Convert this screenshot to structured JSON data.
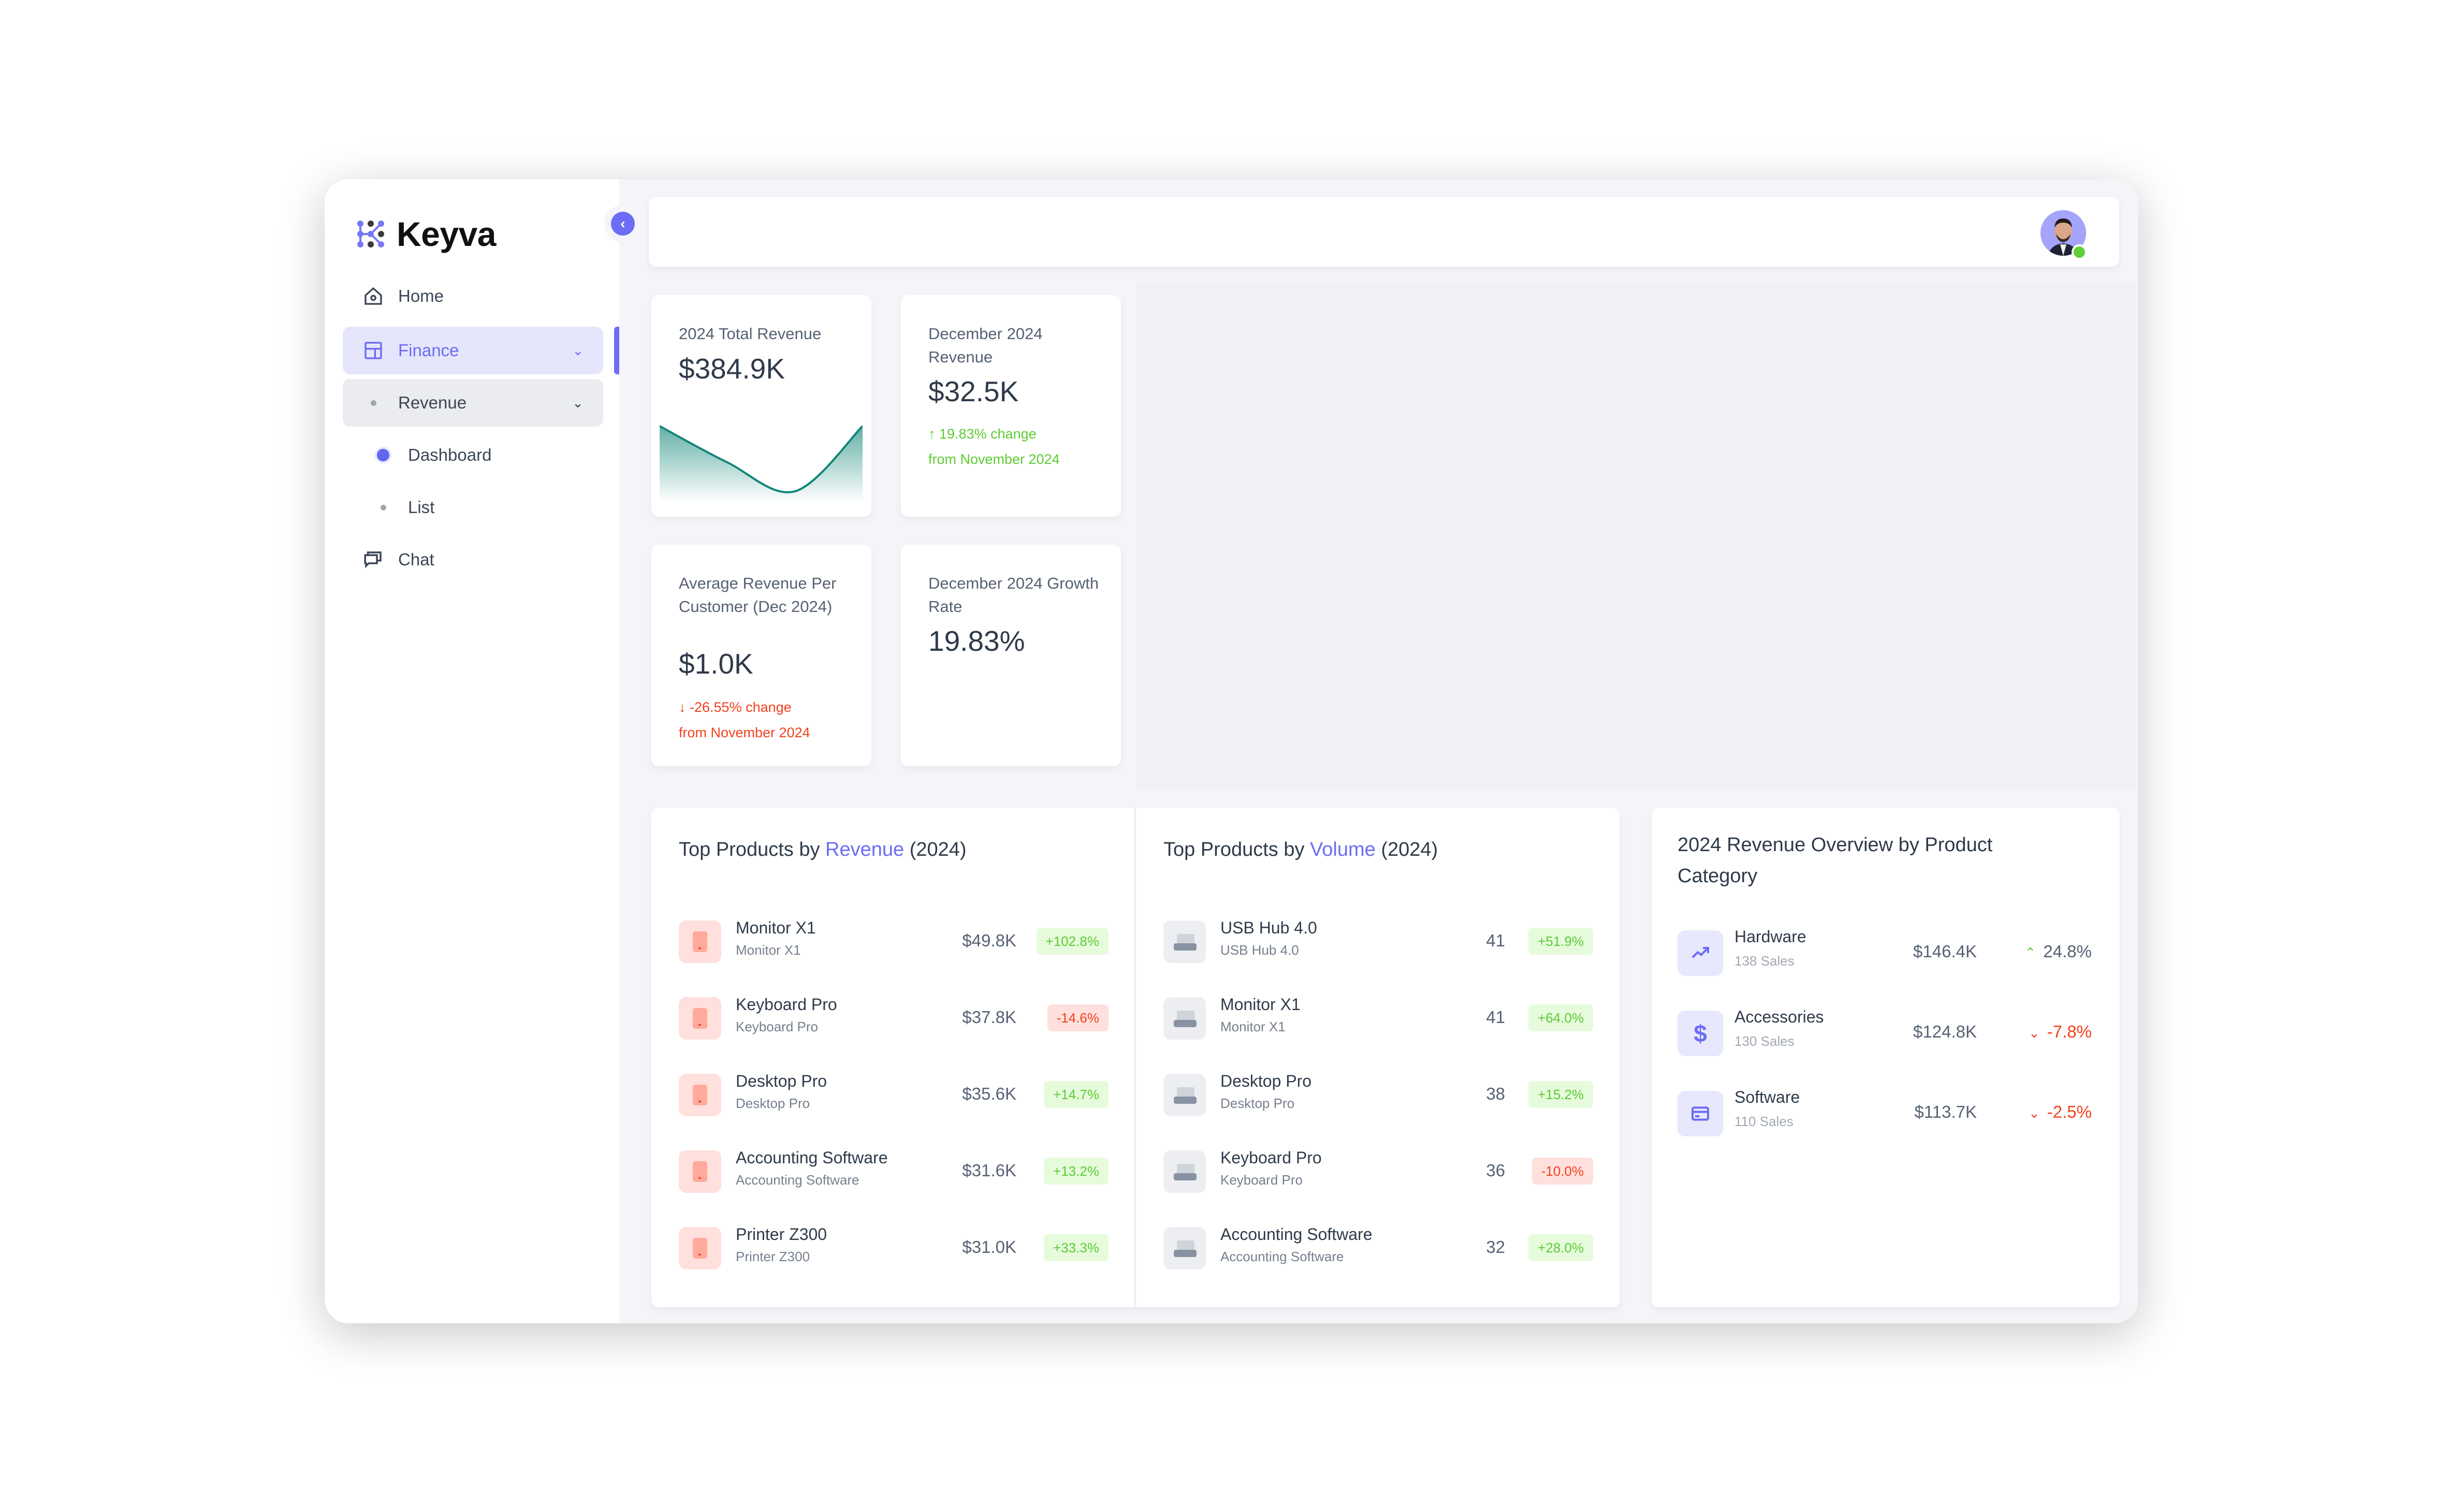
{
  "app": {
    "brand": "Keyva"
  },
  "sidebar": {
    "collapse_icon": "chevron-left-icon",
    "items": [
      {
        "label": "Home",
        "icon": "home-icon"
      },
      {
        "label": "Finance",
        "icon": "layout-icon",
        "expanded": true,
        "active": true
      },
      {
        "label": "Revenue",
        "icon": "dot-icon",
        "expanded": true
      },
      {
        "label": "Dashboard",
        "icon": "dot-icon",
        "active": true
      },
      {
        "label": "List",
        "icon": "dot-icon"
      },
      {
        "label": "Chat",
        "icon": "chat-icon"
      }
    ]
  },
  "header": {
    "avatar": "user-avatar",
    "status": "online"
  },
  "kpis": [
    {
      "title": "2024 Total Revenue",
      "value": "$384.9K",
      "sparkline": [
        0.95,
        0.45,
        0.05,
        0.95
      ]
    },
    {
      "title": "December 2024 Revenue",
      "value": "$32.5K",
      "change": "19.83% change",
      "change_suffix": "from November 2024",
      "direction": "up"
    },
    {
      "title": "Average Revenue Per Customer (Dec 2024)",
      "value": "$1.0K",
      "change": "-26.55% change",
      "change_suffix": "from November 2024",
      "direction": "down"
    },
    {
      "title": "December 2024 Growth Rate",
      "value": "19.83%"
    }
  ],
  "top_revenue": {
    "title_prefix": "Top Products by",
    "title_highlight": "Revenue",
    "title_suffix": "(2024)",
    "rows": [
      {
        "name": "Monitor X1",
        "sub": "Monitor X1",
        "value": "$49.8K",
        "change": "+102.8%",
        "positive": true
      },
      {
        "name": "Keyboard Pro",
        "sub": "Keyboard Pro",
        "value": "$37.8K",
        "change": "-14.6%",
        "positive": false
      },
      {
        "name": "Desktop Pro",
        "sub": "Desktop Pro",
        "value": "$35.6K",
        "change": "+14.7%",
        "positive": true
      },
      {
        "name": "Accounting Software",
        "sub": "Accounting Software",
        "value": "$31.6K",
        "change": "+13.2%",
        "positive": true
      },
      {
        "name": "Printer Z300",
        "sub": "Printer Z300",
        "value": "$31.0K",
        "change": "+33.3%",
        "positive": true
      }
    ]
  },
  "top_volume": {
    "title_prefix": "Top Products by",
    "title_highlight": "Volume",
    "title_suffix": "(2024)",
    "rows": [
      {
        "name": "USB Hub 4.0",
        "sub": "USB Hub 4.0",
        "value": "41",
        "change": "+51.9%",
        "positive": true
      },
      {
        "name": "Monitor X1",
        "sub": "Monitor X1",
        "value": "41",
        "change": "+64.0%",
        "positive": true
      },
      {
        "name": "Desktop Pro",
        "sub": "Desktop Pro",
        "value": "38",
        "change": "+15.2%",
        "positive": true
      },
      {
        "name": "Keyboard Pro",
        "sub": "Keyboard Pro",
        "value": "36",
        "change": "-10.0%",
        "positive": false
      },
      {
        "name": "Accounting Software",
        "sub": "Accounting Software",
        "value": "32",
        "change": "+28.0%",
        "positive": true
      }
    ]
  },
  "categories": {
    "title": "2024 Revenue Overview by Product Category",
    "rows": [
      {
        "name": "Hardware",
        "sub": "138 Sales",
        "value": "$146.4K",
        "change": "24.8%",
        "positive": true,
        "icon": "trending-up-icon",
        "glyph": "↗"
      },
      {
        "name": "Accessories",
        "sub": "130 Sales",
        "value": "$124.8K",
        "change": "-7.8%",
        "positive": false,
        "icon": "dollar-icon",
        "glyph": "$"
      },
      {
        "name": "Software",
        "sub": "110 Sales",
        "value": "$113.7K",
        "change": "-2.5%",
        "positive": false,
        "icon": "credit-card-icon",
        "glyph": "▭"
      }
    ]
  },
  "colors": {
    "accent": "#6c6cf5",
    "positive": "#5ecb33",
    "negative": "#f2411f",
    "sparkline": "#0f8577"
  }
}
